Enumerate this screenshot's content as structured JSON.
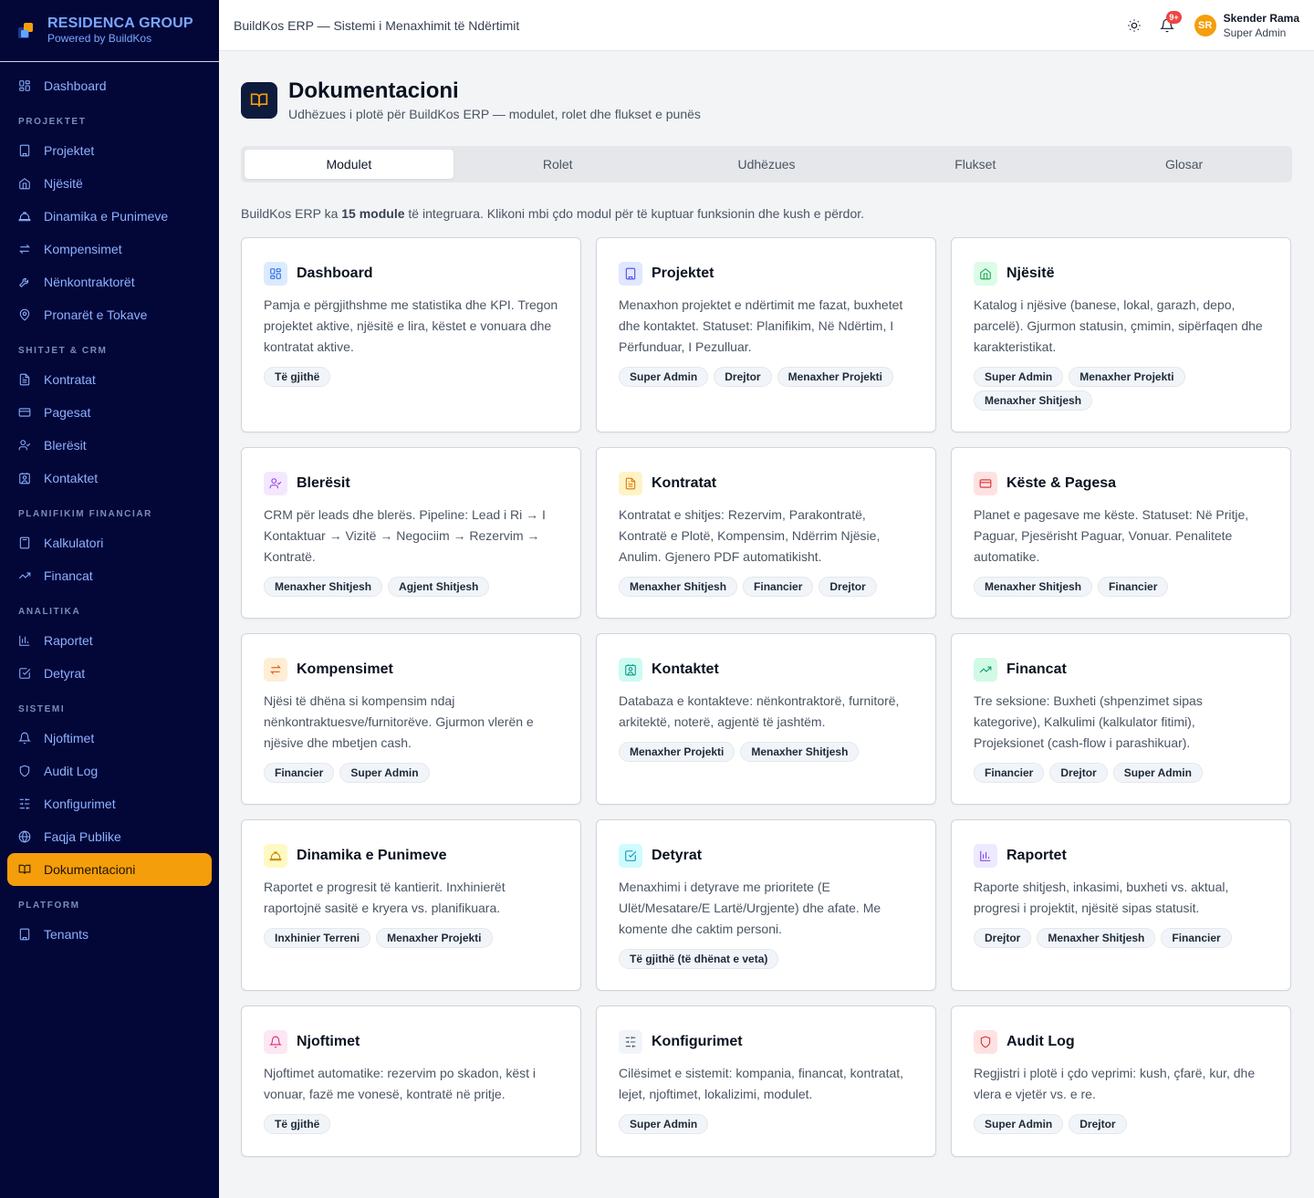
{
  "brand": {
    "name": "RESIDENCA GROUP",
    "sub": "Powered by BuildKos"
  },
  "sidebar": {
    "top": [
      {
        "label": "Dashboard",
        "icon": "dashboard-icon"
      }
    ],
    "sections": [
      {
        "title": "PROJEKTET",
        "items": [
          {
            "label": "Projektet",
            "icon": "building-icon"
          },
          {
            "label": "Njësitë",
            "icon": "home-icon"
          },
          {
            "label": "Dinamika e Punimeve",
            "icon": "hardhat-icon"
          },
          {
            "label": "Kompensimet",
            "icon": "arrows-icon"
          },
          {
            "label": "Nënkontraktorët",
            "icon": "wrench-icon"
          },
          {
            "label": "Pronarët e Tokave",
            "icon": "map-pin-icon"
          }
        ]
      },
      {
        "title": "SHITJET & CRM",
        "items": [
          {
            "label": "Kontratat",
            "icon": "file-icon"
          },
          {
            "label": "Pagesat",
            "icon": "credit-card-icon"
          },
          {
            "label": "Blerësit",
            "icon": "user-check-icon"
          },
          {
            "label": "Kontaktet",
            "icon": "contact-icon"
          }
        ]
      },
      {
        "title": "PLANIFIKIM FINANCIAR",
        "items": [
          {
            "label": "Kalkulatori",
            "icon": "calculator-icon"
          },
          {
            "label": "Financat",
            "icon": "trending-icon"
          }
        ]
      },
      {
        "title": "ANALITIKA",
        "items": [
          {
            "label": "Raportet",
            "icon": "bar-chart-icon"
          },
          {
            "label": "Detyrat",
            "icon": "check-square-icon"
          }
        ]
      },
      {
        "title": "SISTEMI",
        "items": [
          {
            "label": "Njoftimet",
            "icon": "bell-icon"
          },
          {
            "label": "Audit Log",
            "icon": "shield-icon"
          },
          {
            "label": "Konfigurimet",
            "icon": "sliders-icon"
          },
          {
            "label": "Faqja Publike",
            "icon": "globe-icon"
          },
          {
            "label": "Dokumentacioni",
            "icon": "book-icon",
            "active": true
          }
        ]
      },
      {
        "title": "PLATFORM",
        "items": [
          {
            "label": "Tenants",
            "icon": "building-icon"
          }
        ]
      }
    ]
  },
  "header": {
    "title": "BuildKos ERP — Sistemi i Menaxhimit të Ndërtimit",
    "notif_badge": "9+",
    "user_initials": "SR",
    "user_name": "Skender Rama",
    "user_role": "Super Admin"
  },
  "page": {
    "title": "Dokumentacioni",
    "subtitle": "Udhëzues i plotë për BuildKos ERP — modulet, rolet dhe flukset e punës",
    "tabs": [
      "Modulet",
      "Rolet",
      "Udhëzues",
      "Flukset",
      "Glosar"
    ],
    "intro_pre": "BuildKos ERP ka ",
    "intro_bold": "15 module",
    "intro_post": " të integruara. Klikoni mbi çdo modul për të kuptuar funksionin dhe kush e përdor."
  },
  "modules": [
    {
      "title": "Dashboard",
      "icon": "dashboard-icon",
      "bg": "#dbeafe",
      "fg": "#2563eb",
      "height": 214,
      "desc": "Pamja e përgjithshme me statistika dhe KPI. Tregon projektet aktive, njësitë e lira, këstet e vonuara dhe kontratat aktive.",
      "roles": [
        "Të gjithë"
      ]
    },
    {
      "title": "Projektet",
      "icon": "building-icon",
      "bg": "#e0e7ff",
      "fg": "#4f46e5",
      "height": 214,
      "desc": "Menaxhon projektet e ndërtimit me fazat, buxhetet dhe kontaktet. Statuset: Planifikim, Në Ndërtim, I Përfunduar, I Pezulluar.",
      "roles": [
        "Super Admin",
        "Drejtor",
        "Menaxher Projekti"
      ]
    },
    {
      "title": "Njësitë",
      "icon": "home-icon",
      "bg": "#dcfce7",
      "fg": "#16a34a",
      "height": 214,
      "desc": "Katalog i njësive (banese, lokal, garazh, depo, parcelë). Gjurmon statusin, çmimin, sipërfaqen dhe karakteristikat.",
      "roles": [
        "Super Admin",
        "Menaxher Projekti",
        "Menaxher Shitjesh"
      ]
    },
    {
      "title": "Blerësit",
      "icon": "user-check-icon",
      "bg": "#f3e8ff",
      "fg": "#9333ea",
      "height": 188,
      "desc": "CRM për leads dhe blerës. Pipeline: Lead i Ri → I Kontaktuar → Vizitë → Negociim → Rezervim → Kontratë.",
      "roles": [
        "Menaxher Shitjesh",
        "Agjent Shitjesh"
      ]
    },
    {
      "title": "Kontratat",
      "icon": "file-icon",
      "bg": "#fef3c7",
      "fg": "#d97706",
      "height": 188,
      "desc": "Kontratat e shitjes: Rezervim, Parakontratë, Kontratë e Plotë, Kompensim, Ndërrim Njësie, Anulim. Gjenero PDF automatikisht.",
      "roles": [
        "Menaxher Shitjesh",
        "Financier",
        "Drejtor"
      ]
    },
    {
      "title": "Këste & Pagesa",
      "icon": "credit-card-icon",
      "bg": "#fee2e2",
      "fg": "#dc2626",
      "height": 188,
      "desc": "Planet e pagesave me këste. Statuset: Në Pritje, Paguar, Pjesërisht Paguar, Vonuar. Penalitete automatike.",
      "roles": [
        "Menaxher Shitjesh",
        "Financier"
      ]
    },
    {
      "title": "Kompensimet",
      "icon": "arrows-icon",
      "bg": "#ffedd5",
      "fg": "#ea580c",
      "height": 188,
      "desc": "Njësi të dhëna si kompensim ndaj nënkontraktuesve/furnitorëve. Gjurmon vlerën e njësive dhe mbetjen cash.",
      "roles": [
        "Financier",
        "Super Admin"
      ]
    },
    {
      "title": "Kontaktet",
      "icon": "contact-icon",
      "bg": "#ccfbf1",
      "fg": "#0d9488",
      "height": 188,
      "desc": "Databaza e kontakteve: nënkontraktorë, furnitorë, arkitektë, noterë, agjentë të jashtëm.",
      "roles": [
        "Menaxher Projekti",
        "Menaxher Shitjesh"
      ]
    },
    {
      "title": "Financat",
      "icon": "trending-icon",
      "bg": "#d1fae5",
      "fg": "#059669",
      "height": 188,
      "desc": "Tre seksione: Buxheti (shpenzimet sipas kategorive), Kalkulimi (kalkulator fitimi), Projeksionet (cash-flow i parashikuar).",
      "roles": [
        "Financier",
        "Drejtor",
        "Super Admin"
      ]
    },
    {
      "title": "Dinamika e Punimeve",
      "icon": "hardhat-icon",
      "bg": "#fef9c3",
      "fg": "#ca8a04",
      "height": 188,
      "desc": "Raportet e progresit të kantierit. Inxhinierët raportojnë sasitë e kryera vs. planifikuara.",
      "roles": [
        "Inxhinier Terreni",
        "Menaxher Projekti"
      ]
    },
    {
      "title": "Detyrat",
      "icon": "check-square-icon",
      "bg": "#cffafe",
      "fg": "#0891b2",
      "height": 188,
      "desc": "Menaxhimi i detyrave me prioritete (E Ulët/Mesatare/E Lartë/Urgjente) dhe afate. Me komente dhe caktim personi.",
      "roles": [
        "Të gjithë (të dhënat e veta)"
      ]
    },
    {
      "title": "Raportet",
      "icon": "bar-chart-icon",
      "bg": "#ede9fe",
      "fg": "#7c3aed",
      "height": 188,
      "desc": "Raporte shitjesh, inkasimi, buxheti vs. aktual, progresi i projektit, njësitë sipas statusit.",
      "roles": [
        "Drejtor",
        "Menaxher Shitjesh",
        "Financier"
      ]
    },
    {
      "title": "Njoftimet",
      "icon": "bell-icon",
      "bg": "#fce7f3",
      "fg": "#db2777",
      "height": 166,
      "desc": "Njoftimet automatike: rezervim po skadon, këst i vonuar, fazë me vonesë, kontratë në pritje.",
      "roles": [
        "Të gjithë"
      ]
    },
    {
      "title": "Konfigurimet",
      "icon": "sliders-icon",
      "bg": "#f1f5f9",
      "fg": "#475569",
      "height": 166,
      "desc": "Cilësimet e sistemit: kompania, financat, kontratat, lejet, njoftimet, lokalizimi, modulet.",
      "roles": [
        "Super Admin"
      ]
    },
    {
      "title": "Audit Log",
      "icon": "shield-icon",
      "bg": "#fee2e2",
      "fg": "#dc2626",
      "height": 166,
      "desc": "Regjistri i plotë i çdo veprimi: kush, çfarë, kur, dhe vlera e vjetër vs. e re.",
      "roles": [
        "Super Admin",
        "Drejtor"
      ]
    }
  ]
}
